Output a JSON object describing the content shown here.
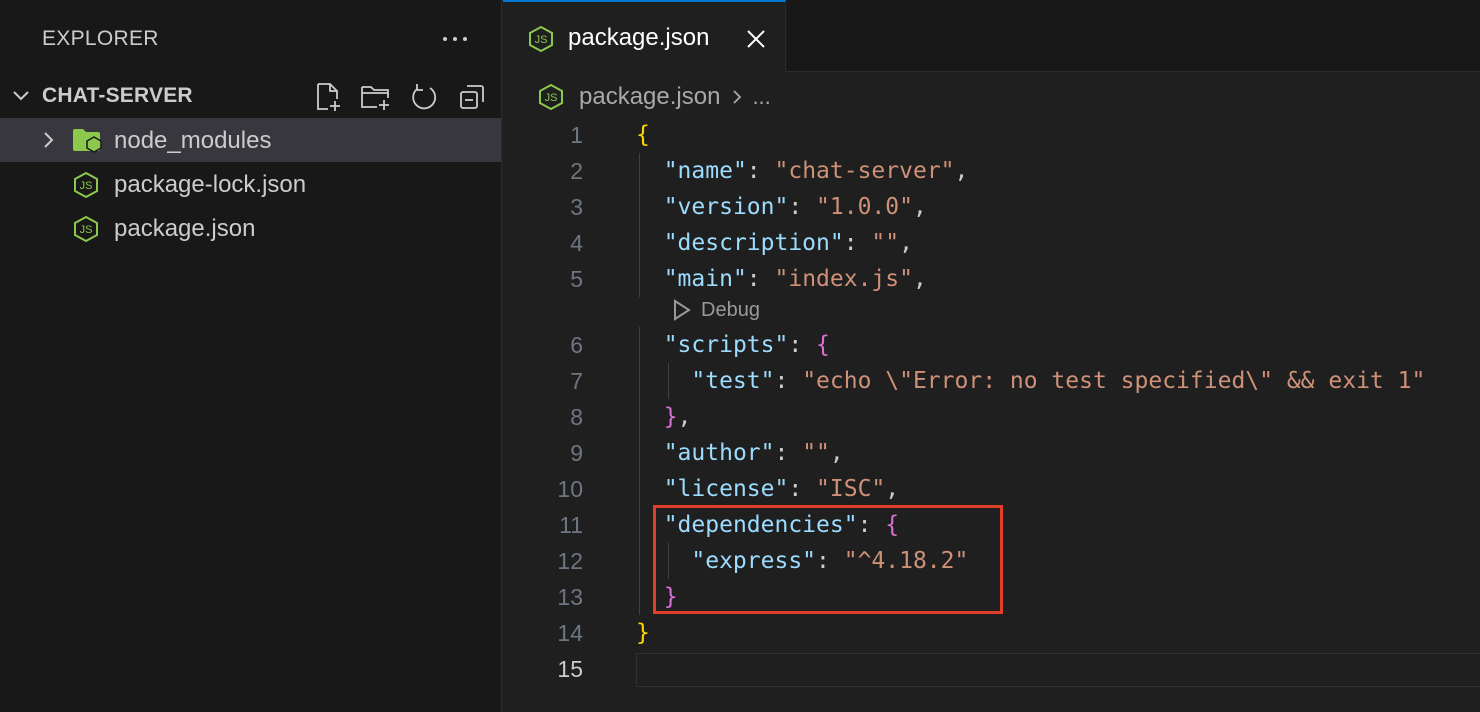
{
  "sidebar": {
    "title": "EXPLORER",
    "folder": "CHAT-SERVER",
    "items": [
      {
        "label": "node_modules",
        "icon": "folder-node-icon"
      },
      {
        "label": "package-lock.json",
        "icon": "nodejs-icon"
      },
      {
        "label": "package.json",
        "icon": "nodejs-icon"
      }
    ]
  },
  "tabs": [
    {
      "label": "package.json",
      "icon": "nodejs-icon"
    }
  ],
  "breadcrumb": {
    "file": "package.json",
    "more": "..."
  },
  "codelens": {
    "label": "Debug"
  },
  "editor": {
    "line_numbers": [
      "1",
      "2",
      "3",
      "4",
      "5",
      "6",
      "7",
      "8",
      "9",
      "10",
      "11",
      "12",
      "13",
      "14",
      "15"
    ],
    "active_line": "15",
    "lines": [
      [
        {
          "t": "{",
          "c": "b1"
        }
      ],
      [
        {
          "t": "  "
        },
        {
          "t": "\"name\"",
          "c": "k"
        },
        {
          "t": ": "
        },
        {
          "t": "\"chat-server\"",
          "c": "s"
        },
        {
          "t": ","
        }
      ],
      [
        {
          "t": "  "
        },
        {
          "t": "\"version\"",
          "c": "k"
        },
        {
          "t": ": "
        },
        {
          "t": "\"1.0.0\"",
          "c": "s"
        },
        {
          "t": ","
        }
      ],
      [
        {
          "t": "  "
        },
        {
          "t": "\"description\"",
          "c": "k"
        },
        {
          "t": ": "
        },
        {
          "t": "\"\"",
          "c": "s"
        },
        {
          "t": ","
        }
      ],
      [
        {
          "t": "  "
        },
        {
          "t": "\"main\"",
          "c": "k"
        },
        {
          "t": ": "
        },
        {
          "t": "\"index.js\"",
          "c": "s"
        },
        {
          "t": ","
        }
      ],
      [
        {
          "t": "  "
        },
        {
          "t": "\"scripts\"",
          "c": "k"
        },
        {
          "t": ": "
        },
        {
          "t": "{",
          "c": "b2"
        }
      ],
      [
        {
          "t": "    "
        },
        {
          "t": "\"test\"",
          "c": "k"
        },
        {
          "t": ": "
        },
        {
          "t": "\"echo \\\"Error: no test specified\\\" && exit 1\"",
          "c": "s"
        }
      ],
      [
        {
          "t": "  "
        },
        {
          "t": "}",
          "c": "b2"
        },
        {
          "t": ","
        }
      ],
      [
        {
          "t": "  "
        },
        {
          "t": "\"author\"",
          "c": "k"
        },
        {
          "t": ": "
        },
        {
          "t": "\"\"",
          "c": "s"
        },
        {
          "t": ","
        }
      ],
      [
        {
          "t": "  "
        },
        {
          "t": "\"license\"",
          "c": "k"
        },
        {
          "t": ": "
        },
        {
          "t": "\"ISC\"",
          "c": "s"
        },
        {
          "t": ","
        }
      ],
      [
        {
          "t": "  "
        },
        {
          "t": "\"dependencies\"",
          "c": "k"
        },
        {
          "t": ": "
        },
        {
          "t": "{",
          "c": "b2"
        }
      ],
      [
        {
          "t": "    "
        },
        {
          "t": "\"express\"",
          "c": "k"
        },
        {
          "t": ": "
        },
        {
          "t": "\"^4.18.2\"",
          "c": "s"
        }
      ],
      [
        {
          "t": "  "
        },
        {
          "t": "}",
          "c": "b2"
        }
      ],
      [
        {
          "t": "}",
          "c": "b1"
        }
      ],
      []
    ]
  },
  "colors": {
    "accent": "#0078d4",
    "highlight": "#e0402a",
    "node_green": "#8cc84b"
  }
}
